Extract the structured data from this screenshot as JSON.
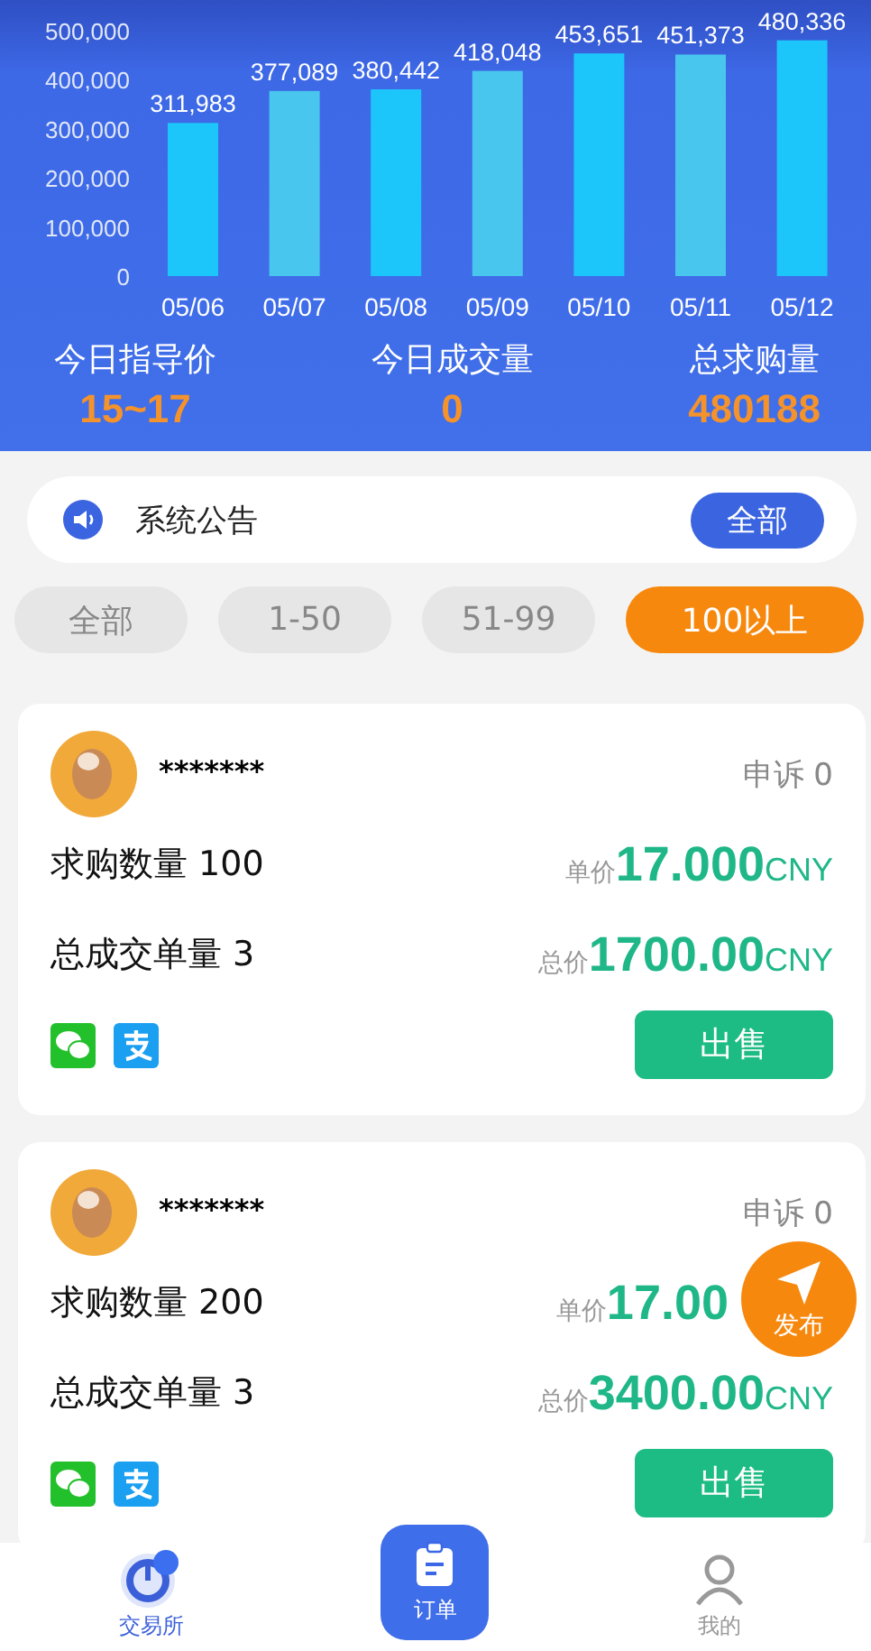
{
  "chart": {
    "chart_data": {
      "type": "bar",
      "categories": [
        "05/06",
        "05/07",
        "05/08",
        "05/09",
        "05/10",
        "05/11",
        "05/12"
      ],
      "series": [
        {
          "color": "#1cc6fb",
          "values": [
            311983,
            377089,
            380442,
            418048,
            453651,
            451373,
            480336
          ]
        }
      ],
      "ylim": [
        0,
        500000
      ],
      "yticks": [
        {
          "value": 0,
          "label": "0"
        },
        {
          "value": 100000,
          "label": "100,000"
        },
        {
          "value": 200000,
          "label": "200,000"
        },
        {
          "value": 300000,
          "label": "300,000"
        },
        {
          "value": 400000,
          "label": "400,000"
        },
        {
          "value": 500000,
          "label": "500,000"
        }
      ],
      "value_labels": [
        "311,983",
        "377,089",
        "380,442",
        "418,048",
        "453,651",
        "451,373",
        "480,336"
      ]
    }
  },
  "stats": [
    {
      "label": "今日指导价",
      "value": "15~17"
    },
    {
      "label": "今日成交量",
      "value": "0"
    },
    {
      "label": "总求购量",
      "value": "480188"
    }
  ],
  "notice": {
    "title": "系统公告",
    "button": "全部"
  },
  "filters": [
    {
      "label": "全部",
      "selected": false
    },
    {
      "label": "1-50",
      "selected": false
    },
    {
      "label": "51-99",
      "selected": false
    },
    {
      "label": "100以上",
      "selected": true
    }
  ],
  "orders": [
    {
      "name": "*******",
      "complaints": "申诉 0",
      "quantity": "求购数量 100",
      "deals": "总成交单量 3",
      "unit_price_label": "单价",
      "unit_price": "17.000",
      "unit_price_currency": "CNY",
      "total_label": "总价",
      "total": "1700.00",
      "total_currency": "CNY",
      "sell": "出售"
    },
    {
      "name": "*******",
      "complaints": "申诉 0",
      "quantity": "求购数量 200",
      "deals": "总成交单量 3",
      "unit_price_label": "单价",
      "unit_price": "17.00",
      "total_label": "总价",
      "total": "3400.00",
      "total_currency": "CNY",
      "sell": "出售"
    }
  ],
  "publish": {
    "label": "发布"
  },
  "nav": [
    {
      "kind": "exchange",
      "label": "交易所"
    },
    {
      "kind": "orders",
      "label": "订单"
    },
    {
      "kind": "mine",
      "label": "我的"
    }
  ]
}
